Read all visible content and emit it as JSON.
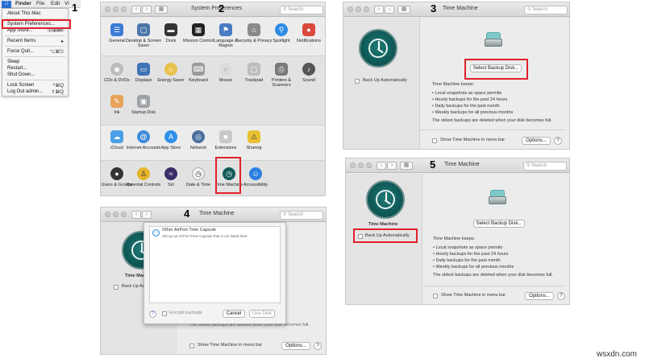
{
  "steps": {
    "s1": "1",
    "s2": "2",
    "s3": "3",
    "s4": "4",
    "s5": "5"
  },
  "menubar": {
    "finder": "Finder",
    "file": "File",
    "edit": "Edit",
    "view": "Vi"
  },
  "apple_menu": {
    "items": [
      {
        "label": "About This Mac",
        "shortcut": ""
      },
      {
        "label": "System Preferences...",
        "shortcut": ""
      },
      {
        "label": "App Store...",
        "shortcut": "1 update"
      },
      {
        "label": "Recent Items",
        "shortcut": "▸"
      },
      {
        "label": "Force Quit...",
        "shortcut": "⌥⌘⎋"
      },
      {
        "label": "Sleep",
        "shortcut": ""
      },
      {
        "label": "Restart...",
        "shortcut": ""
      },
      {
        "label": "Shut Down...",
        "shortcut": ""
      },
      {
        "label": "Lock Screen",
        "shortcut": "^⌘Q"
      },
      {
        "label": "Log Out admin...",
        "shortcut": "⇧⌘Q"
      }
    ]
  },
  "sysprefs": {
    "title": "System Preferences",
    "search_placeholder": "Search",
    "row1": [
      "General",
      "Desktop & Screen Saver",
      "Dock",
      "Mission Control",
      "Language & Region",
      "Security & Privacy",
      "Spotlight",
      "Notifications"
    ],
    "row2": [
      "CDs & DVDs",
      "Displays",
      "Energy Saver",
      "Keyboard",
      "Mouse",
      "Trackpad",
      "Printers & Scanners",
      "Sound"
    ],
    "row3": [
      "Ink",
      "Startup Disk"
    ],
    "row4": [
      "iCloud",
      "Internet Accounts",
      "App Store",
      "Network",
      "Extensions",
      "Sharing"
    ],
    "row5": [
      "Users & Groups",
      "Parental Controls",
      "Siri",
      "Date & Time",
      "Time Machine",
      "Accessibility"
    ]
  },
  "tm": {
    "title": "Time Machine",
    "search_placeholder": "Search",
    "app_name": "Time Machine",
    "select_disk": "Select Backup Disk...",
    "back_up_auto": "Back Up Automatically",
    "keeps": "Time Machine keeps:",
    "bullets": [
      "• Local snapshots as space permits",
      "• Hourly backups for the past 24 hours",
      "• Daily backups for the past month",
      "• Weekly backups for all previous months"
    ],
    "oldest": "The oldest backups are deleted when your disk becomes full.",
    "show_menu": "Show Time Machine in menu bar",
    "options": "Options..."
  },
  "tm_sheet": {
    "window_title": "Time Machine",
    "search_placeholder": "Search",
    "back_up_partial": "Back Up Au",
    "app_partial": "Time Mach",
    "item_title": "Other AirPort Time Capsule",
    "item_sub": "Set up an AirPort Time Capsule that is not listed here",
    "help": "?",
    "encrypt": "Encrypt backups",
    "cancel": "Cancel",
    "use_disk": "Use Disk",
    "bottom_text": "The oldest backups are deleted when your disk becomes full.",
    "show_menu": "Show Time Machine in menu bar",
    "options": "Options..."
  },
  "watermark": "wsxdn.com"
}
